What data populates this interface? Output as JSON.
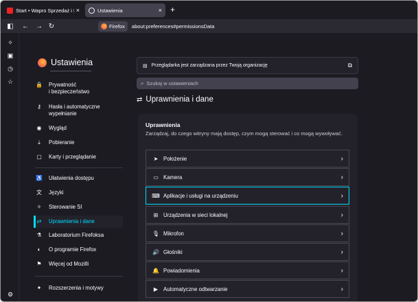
{
  "tabs": [
    {
      "label": "Start • Wapro Sprzedaż i Magaz",
      "close": "×"
    },
    {
      "label": "Ustawienia",
      "close": "×"
    }
  ],
  "newtab": "+",
  "navbar": {
    "badge": "Firefox",
    "url": "about:preferences#permissionsData"
  },
  "sidebar": {
    "title": "Ustawienia",
    "items": [
      {
        "icon": "lock-icon",
        "glyph": "🔒",
        "label": "Prywatność",
        "label2": "i bezpieczeństwo"
      },
      {
        "icon": "key-icon",
        "glyph": "⚷",
        "label": "Hasła i automatyczne",
        "label2": "wypełnianie"
      },
      {
        "icon": "eye-icon",
        "glyph": "◉",
        "label": "Wygląd"
      },
      {
        "icon": "download-icon",
        "glyph": "⤓",
        "label": "Pobieranie"
      },
      {
        "icon": "tabs-icon",
        "glyph": "▢",
        "label": "Karty i przeglądanie"
      },
      {
        "icon": "accessibility-icon",
        "glyph": "♿",
        "label": "Ułatwienia dostępu"
      },
      {
        "icon": "language-icon",
        "glyph": "文",
        "label": "Języki"
      },
      {
        "icon": "ai-icon",
        "glyph": "✧",
        "label": "Sterowanie SI"
      },
      {
        "icon": "permissions-icon",
        "glyph": "⇄",
        "label": "Uprawnienia i dane"
      },
      {
        "icon": "flask-icon",
        "glyph": "⚗",
        "label": "Laboratorium Firefoksa"
      },
      {
        "icon": "firefox-icon",
        "glyph": "◐",
        "label": "O programie Firefox"
      },
      {
        "icon": "mozilla-icon",
        "glyph": "⚑",
        "label": "Więcej od Mozilli"
      },
      {
        "icon": "extensions-icon",
        "glyph": "✦",
        "label": "Rozszerzenia i motywy"
      }
    ]
  },
  "policy": {
    "text": "Przeglądarka jest zarządzana przez Twoją organizację",
    "glyph": "▤",
    "ext": "⧉"
  },
  "search": {
    "placeholder": "Szukaj w ustawieniach",
    "glyph": "⌕"
  },
  "page": {
    "title": "Uprawnienia i dane",
    "glyph": "⇄"
  },
  "card": {
    "title": "Uprawnienia",
    "desc": "Zarządzaj, do czego witryny mają dostęp, czym mogą sterować i co mogą wywoływać.",
    "rows": [
      {
        "icon": "location-icon",
        "glyph": "➤",
        "label": "Położenie"
      },
      {
        "icon": "camera-icon",
        "glyph": "▭",
        "label": "Kamera"
      },
      {
        "icon": "laptop-icon",
        "glyph": "⌨",
        "label": "Aplikacje i usługi na urządzeniu"
      },
      {
        "icon": "network-icon",
        "glyph": "⊞",
        "label": "Urządzenia w sieci lokalnej"
      },
      {
        "icon": "microphone-icon",
        "glyph": "🎙",
        "label": "Mikrofon"
      },
      {
        "icon": "speaker-icon",
        "glyph": "🔊",
        "label": "Głośniki"
      },
      {
        "icon": "bell-icon",
        "glyph": "🔔",
        "label": "Powiadomienia"
      },
      {
        "icon": "autoplay-icon",
        "glyph": "▶",
        "label": "Automatyczne odtwarzanie"
      }
    ],
    "chev": "›"
  }
}
